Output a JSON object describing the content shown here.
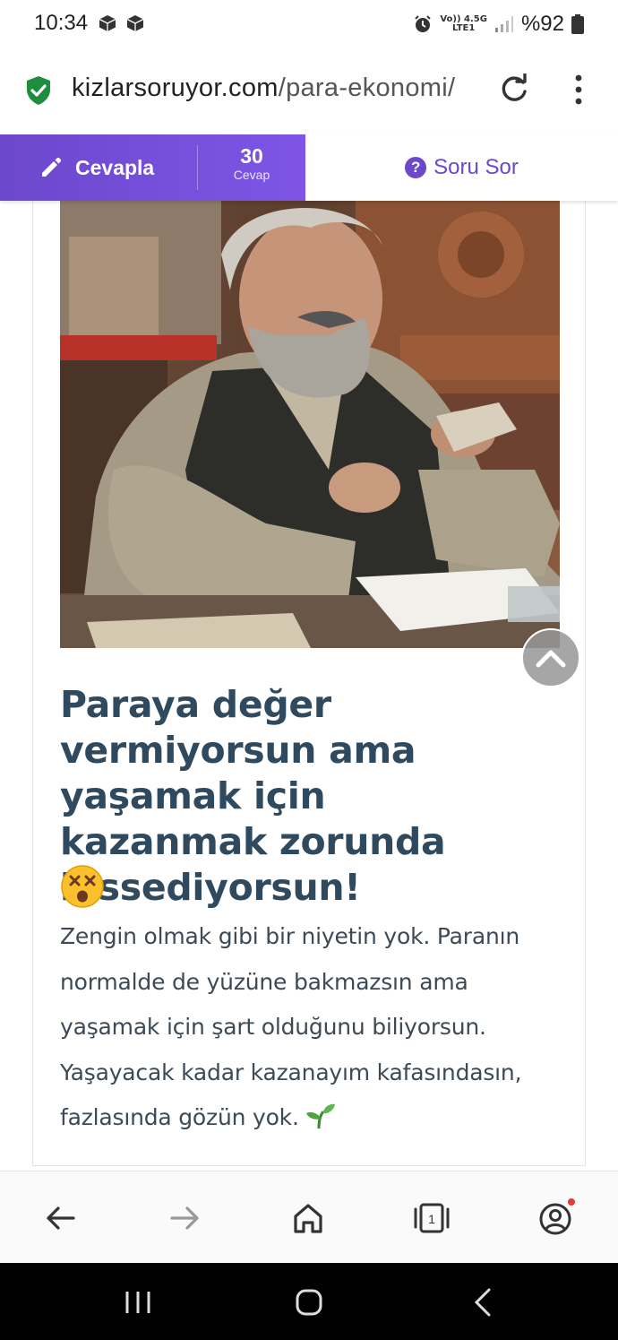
{
  "status_bar": {
    "time": "10:34",
    "network_top": "Vo)) 4.5G",
    "network_bottom": "LTE1",
    "battery": "%92"
  },
  "browser": {
    "url_host": "kizlarsoruyor.com",
    "url_path": "/para-ekonomi/",
    "tab_count": "1"
  },
  "action_bar": {
    "answer_label": "Cevapla",
    "answer_count": "30",
    "answer_count_caption": "Cevap",
    "ask_label": "Soru Sor"
  },
  "article": {
    "title": "Paraya değer vermiyorsun ama yaşamak için kazanmak zorunda hissediyorsun!",
    "body": "Zengin olmak gibi bir niyetin yok. Paranın normalde de yüzüne bakmazsın ama yaşamak için şart olduğunu biliyorsun. Yaşayacak kadar kazanayım kafasındasın, fazlasında gözün yok."
  },
  "colors": {
    "brand_purple": "#6c48cc",
    "title_color": "#2f4a5f",
    "shield_green": "#1e8e3e",
    "notification_dot": "#e53935"
  },
  "icons": [
    "shield-check-icon",
    "reload-icon",
    "kebab-menu-icon",
    "pencil-icon",
    "question-circle-icon",
    "chevron-up-icon",
    "dizzy-face-emoji",
    "seedling-emoji",
    "back-arrow-icon",
    "forward-arrow-icon",
    "home-icon",
    "tabs-icon",
    "account-icon",
    "recents-icon",
    "home-circle-icon",
    "back-chevron-icon"
  ]
}
